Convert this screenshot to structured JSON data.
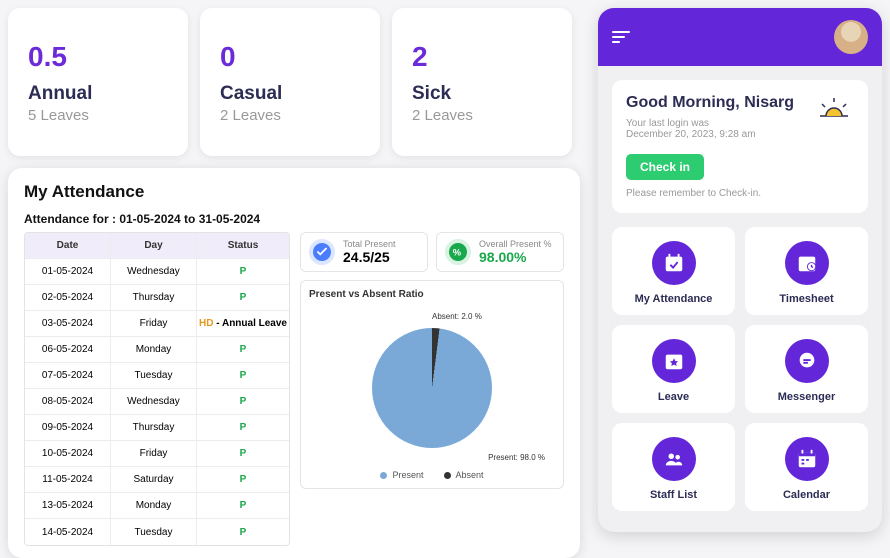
{
  "leave_cards": [
    {
      "number": "0.5",
      "type": "Annual",
      "sub": "5 Leaves"
    },
    {
      "number": "0",
      "type": "Casual",
      "sub": "2 Leaves"
    },
    {
      "number": "2",
      "type": "Sick",
      "sub": "2 Leaves"
    }
  ],
  "attendance": {
    "title": "My Attendance",
    "range_label": "Attendance for : 01-05-2024 to 31-05-2024",
    "columns": {
      "date": "Date",
      "day": "Day",
      "status": "Status"
    },
    "rows": [
      {
        "date": "01-05-2024",
        "day": "Wednesday",
        "status": "P"
      },
      {
        "date": "02-05-2024",
        "day": "Thursday",
        "status": "P"
      },
      {
        "date": "03-05-2024",
        "day": "Friday",
        "status": "HD - Annual Leave"
      },
      {
        "date": "06-05-2024",
        "day": "Monday",
        "status": "P"
      },
      {
        "date": "07-05-2024",
        "day": "Tuesday",
        "status": "P"
      },
      {
        "date": "08-05-2024",
        "day": "Wednesday",
        "status": "P"
      },
      {
        "date": "09-05-2024",
        "day": "Thursday",
        "status": "P"
      },
      {
        "date": "10-05-2024",
        "day": "Friday",
        "status": "P"
      },
      {
        "date": "11-05-2024",
        "day": "Saturday",
        "status": "P"
      },
      {
        "date": "13-05-2024",
        "day": "Monday",
        "status": "P"
      },
      {
        "date": "14-05-2024",
        "day": "Tuesday",
        "status": "P"
      }
    ],
    "total_present": {
      "label": "Total Present",
      "value": "24.5/25"
    },
    "overall_pct": {
      "label": "Overall Present %",
      "value": "98.00%"
    },
    "chart_title": "Present vs Absent Ratio",
    "absent_label": "Absent: 2.0 %",
    "present_label": "Present: 98.0 %",
    "legend": {
      "present": "Present",
      "absent": "Absent"
    }
  },
  "chart_data": {
    "type": "pie",
    "title": "Present vs Absent Ratio",
    "series": [
      {
        "name": "Present",
        "value": 98.0,
        "color": "#7aa9d8"
      },
      {
        "name": "Absent",
        "value": 2.0,
        "color": "#333333"
      }
    ]
  },
  "mobile": {
    "greeting": "Good Morning, Nisarg",
    "login_label": "Your last login was",
    "login_time": "December 20, 2023, 9:28 am",
    "checkin": "Check in",
    "checkin_note": "Please remember to Check-in.",
    "tiles": [
      {
        "label": "My Attendance"
      },
      {
        "label": "Timesheet"
      },
      {
        "label": "Leave"
      },
      {
        "label": "Messenger"
      },
      {
        "label": "Staff List"
      },
      {
        "label": "Calendar"
      }
    ]
  }
}
